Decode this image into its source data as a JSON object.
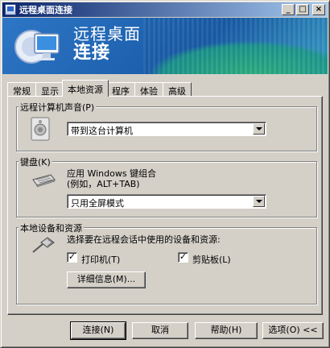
{
  "window": {
    "title": "远程桌面连接",
    "controls": {
      "minimize": "_",
      "maximize": "□",
      "close": "×"
    }
  },
  "banner": {
    "line1": "远程桌面",
    "line2": "连接"
  },
  "tabs": [
    {
      "label": "常规",
      "active": false
    },
    {
      "label": "显示",
      "active": false
    },
    {
      "label": "本地资源",
      "active": true
    },
    {
      "label": "程序",
      "active": false
    },
    {
      "label": "体验",
      "active": false
    },
    {
      "label": "高级",
      "active": false
    }
  ],
  "sound": {
    "group_label": "远程计算机声音(P)",
    "icon": "speaker-icon",
    "selected": "带到这台计算机"
  },
  "keyboard": {
    "group_label": "键盘(K)",
    "icon": "keyboard-icon",
    "desc_line1": "应用 Windows 键组合",
    "desc_line2": "(例如，ALT+TAB)",
    "selected": "只用全屏模式"
  },
  "devices": {
    "group_label": "本地设备和资源",
    "icon": "usb-plug-icon",
    "desc": "选择要在远程会话中使用的设备和资源:",
    "printer_label": "打印机(T)",
    "printer_checked": true,
    "clipboard_label": "剪贴板(L)",
    "clipboard_checked": true,
    "details_button": "详细信息(M)..."
  },
  "buttons": {
    "connect": "连接(N)",
    "cancel": "取消",
    "help": "帮助(H)",
    "options": "选项(O) <<"
  },
  "colors": {
    "titlebar_start": "#0a246a",
    "titlebar_end": "#a6caf0",
    "face": "#d4d0c8",
    "banner": "#1a5ca8"
  }
}
